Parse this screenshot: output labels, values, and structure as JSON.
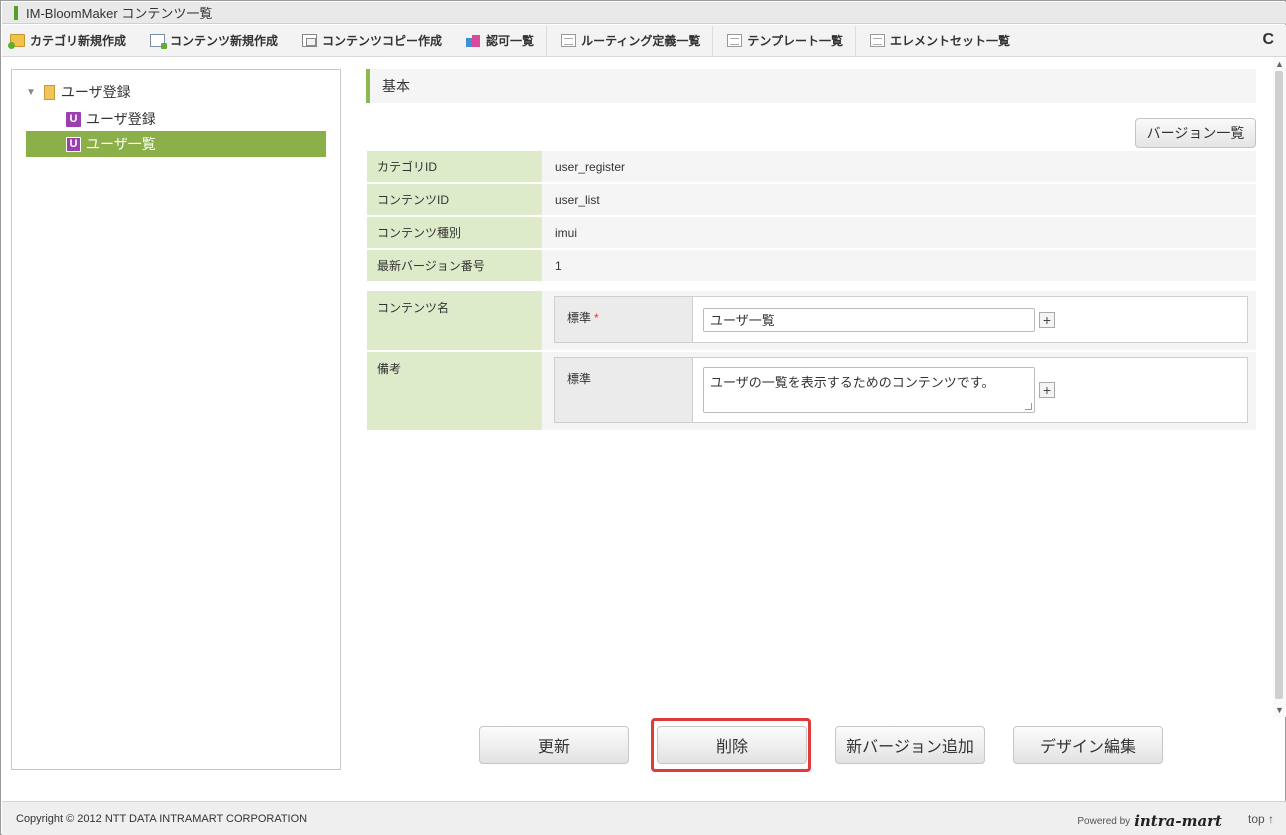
{
  "window": {
    "title": "IM-BloomMaker コンテンツ一覧"
  },
  "toolbar": {
    "items": [
      {
        "label": "カテゴリ新規作成",
        "icon": "folder-add-icon"
      },
      {
        "label": "コンテンツ新規作成",
        "icon": "document-add-icon"
      },
      {
        "label": "コンテンツコピー作成",
        "icon": "copy-icon"
      },
      {
        "label": "認可一覧",
        "icon": "authorization-icon"
      },
      {
        "label": "ルーティング定義一覧",
        "icon": "list-icon"
      },
      {
        "label": "テンプレート一覧",
        "icon": "list-icon"
      },
      {
        "label": "エレメントセット一覧",
        "icon": "list-icon"
      }
    ],
    "refresh_glyph": "C"
  },
  "tree": {
    "root_label": "ユーザ登録",
    "badge": "U",
    "nodes": [
      {
        "label": "ユーザ登録",
        "selected": false
      },
      {
        "label": "ユーザ一覧",
        "selected": true
      }
    ]
  },
  "section": {
    "title": "基本"
  },
  "version_button": "バージョン一覧",
  "info": [
    {
      "key": "カテゴリID",
      "value": "user_register"
    },
    {
      "key": "コンテンツID",
      "value": "user_list"
    },
    {
      "key": "コンテンツ種別",
      "value": "imui"
    },
    {
      "key": "最新バージョン番号",
      "value": "1"
    }
  ],
  "form": {
    "content_name": {
      "label": "コンテンツ名",
      "locale": "標準",
      "required_mark": "*",
      "value": "ユーザ一覧"
    },
    "remarks": {
      "label": "備考",
      "locale": "標準",
      "value": "ユーザの一覧を表示するためのコンテンツです。"
    },
    "plus": "+"
  },
  "actions": {
    "update": "更新",
    "delete": "削除",
    "new_version": "新バージョン追加",
    "design_edit": "デザイン編集"
  },
  "footer": {
    "copyright": "Copyright © 2012 NTT DATA INTRAMART CORPORATION",
    "powered_by": "Powered by",
    "logo_text": "intra-mart",
    "top_link": "top ↑"
  },
  "colors": {
    "accent": "#8bb04a",
    "label_bg": "#deebcb",
    "highlight": "#e03a3a"
  }
}
